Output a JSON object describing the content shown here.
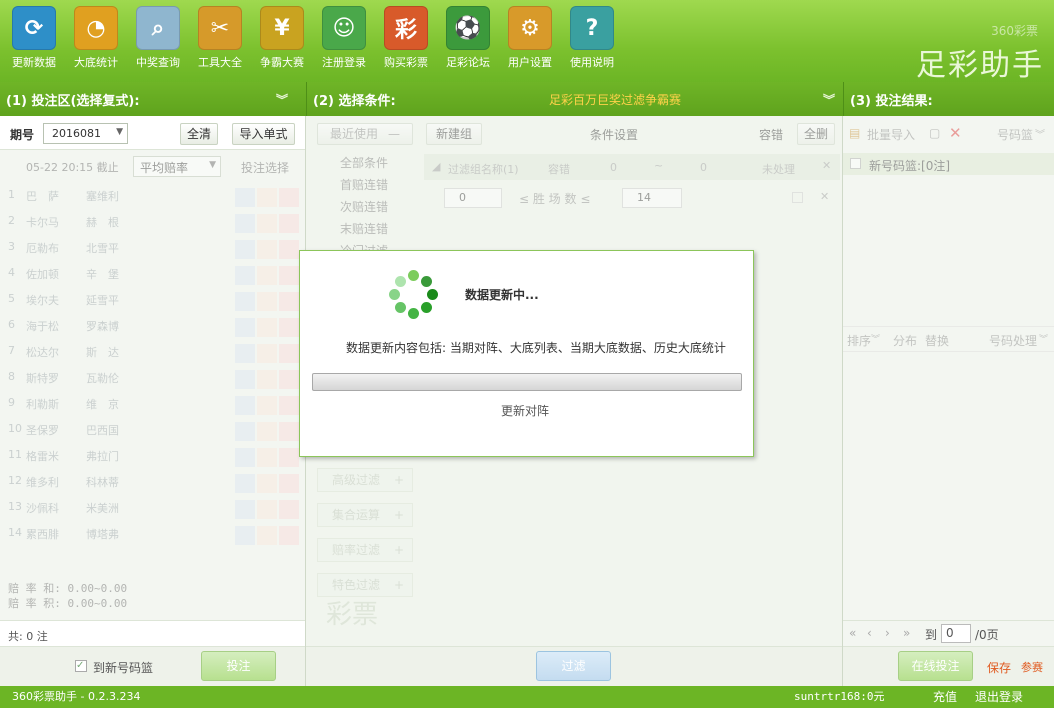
{
  "toolbar": [
    {
      "label": "更新数据",
      "icon": "refresh-icon",
      "color": "#2e8fc8",
      "glyph": "⟳"
    },
    {
      "label": "大底统计",
      "icon": "pie-chart-icon",
      "color": "#e0a020",
      "glyph": "◔"
    },
    {
      "label": "中奖查询",
      "icon": "magnifier-icon",
      "color": "#8fb6cf",
      "glyph": "⌕"
    },
    {
      "label": "工具大全",
      "icon": "tools-icon",
      "color": "#d69a2a",
      "glyph": "✂"
    },
    {
      "label": "争霸大赛",
      "icon": "coin-icon",
      "color": "#c9a320",
      "glyph": "¥"
    },
    {
      "label": "注册登录",
      "icon": "user-icon",
      "color": "#4aa84a",
      "glyph": "☺"
    },
    {
      "label": "购买彩票",
      "icon": "lottery-icon",
      "color": "#d85a2a",
      "glyph": "彩"
    },
    {
      "label": "足彩论坛",
      "icon": "forum-icon",
      "color": "#3c9a3c",
      "glyph": "⚽"
    },
    {
      "label": "用户设置",
      "icon": "gear-icon",
      "color": "#d89a2a",
      "glyph": "⚙"
    },
    {
      "label": "使用说明",
      "icon": "help-icon",
      "color": "#3aa0a0",
      "glyph": "?"
    }
  ],
  "brand": {
    "sub": "360彩票",
    "title": "足彩助手"
  },
  "header1": "(1) 投注区(选择复式):",
  "header2": "(2) 选择条件:",
  "header2_promo": "足彩百万巨奖过滤争霸赛",
  "header3": "(3) 投注结果:",
  "left": {
    "period_label": "期号",
    "period_value": "2016081",
    "clear": "全清",
    "import": "导入单式",
    "deadline": "05-22 20:15 截止",
    "odds": "平均赔率",
    "bet_select": "投注选择",
    "matches": [
      [
        "1",
        "巴　萨",
        "塞维利"
      ],
      [
        "2",
        "卡尔马",
        "赫　根"
      ],
      [
        "3",
        "厄勒布",
        "北雪平"
      ],
      [
        "4",
        "佐加顿",
        "辛　堡"
      ],
      [
        "5",
        "埃尔夫",
        "延雪平"
      ],
      [
        "6",
        "海于松",
        "罗森博"
      ],
      [
        "7",
        "松达尔",
        "斯　达"
      ],
      [
        "8",
        "斯特罗",
        "瓦勒伦"
      ],
      [
        "9",
        "利勒斯",
        "维　京"
      ],
      [
        "10",
        "圣保罗",
        "巴西国"
      ],
      [
        "11",
        "格雷米",
        "弗拉门"
      ],
      [
        "12",
        "维多利",
        "科林蒂"
      ],
      [
        "13",
        "沙佩科",
        "米美洲"
      ],
      [
        "14",
        "累西腓",
        "博塔弗"
      ]
    ],
    "odds_sum": "赔 率 和: 0.00~0.00",
    "odds_prod": "赔 率 积: 0.00~0.00",
    "total": "共: 0 注",
    "to_basket": "到新号码篮",
    "bet_btn": "投注"
  },
  "middle": {
    "recent": "最近使用",
    "list": [
      "全部条件",
      "首赔连错",
      "次赔连错",
      "末赔连错",
      "冷门过滤"
    ],
    "new_group": "新建组",
    "cond_setting": "条件设置",
    "tolerance": "容错",
    "del_all": "全删",
    "group_name": "过滤组名称(1)",
    "tol": "容错",
    "from": "0",
    "tilde": "~",
    "to": "0",
    "unprocessed": "未处理",
    "min": "0",
    "win_label": "≤ 胜 场 数 ≤",
    "max": "14",
    "adv": [
      "高级过滤",
      "集合运算",
      "赔率过滤",
      "特色过滤"
    ],
    "filter_btn": "过滤",
    "watermark": "彩票"
  },
  "right": {
    "batch_import": "批量导入",
    "basket": "号码篮",
    "new_basket": "新号码篮:[0注]",
    "sort": "排序",
    "dist": "分布",
    "replace": "替换",
    "num_process": "号码处理",
    "to": "到",
    "page": "0",
    "pages": "/0页",
    "online_bet": "在线投注",
    "save": "保存",
    "join": "参赛"
  },
  "dialog": {
    "title": "数据更新中...",
    "content": "数据更新内容包括: 当期对阵、大底列表、当期大底数据、历史大底统计",
    "progress": 0,
    "status": "更新对阵"
  },
  "status": {
    "version": "360彩票助手 - 0.2.3.234",
    "user": "suntrtr168:0元",
    "recharge": "充值",
    "logout": "退出登录"
  }
}
